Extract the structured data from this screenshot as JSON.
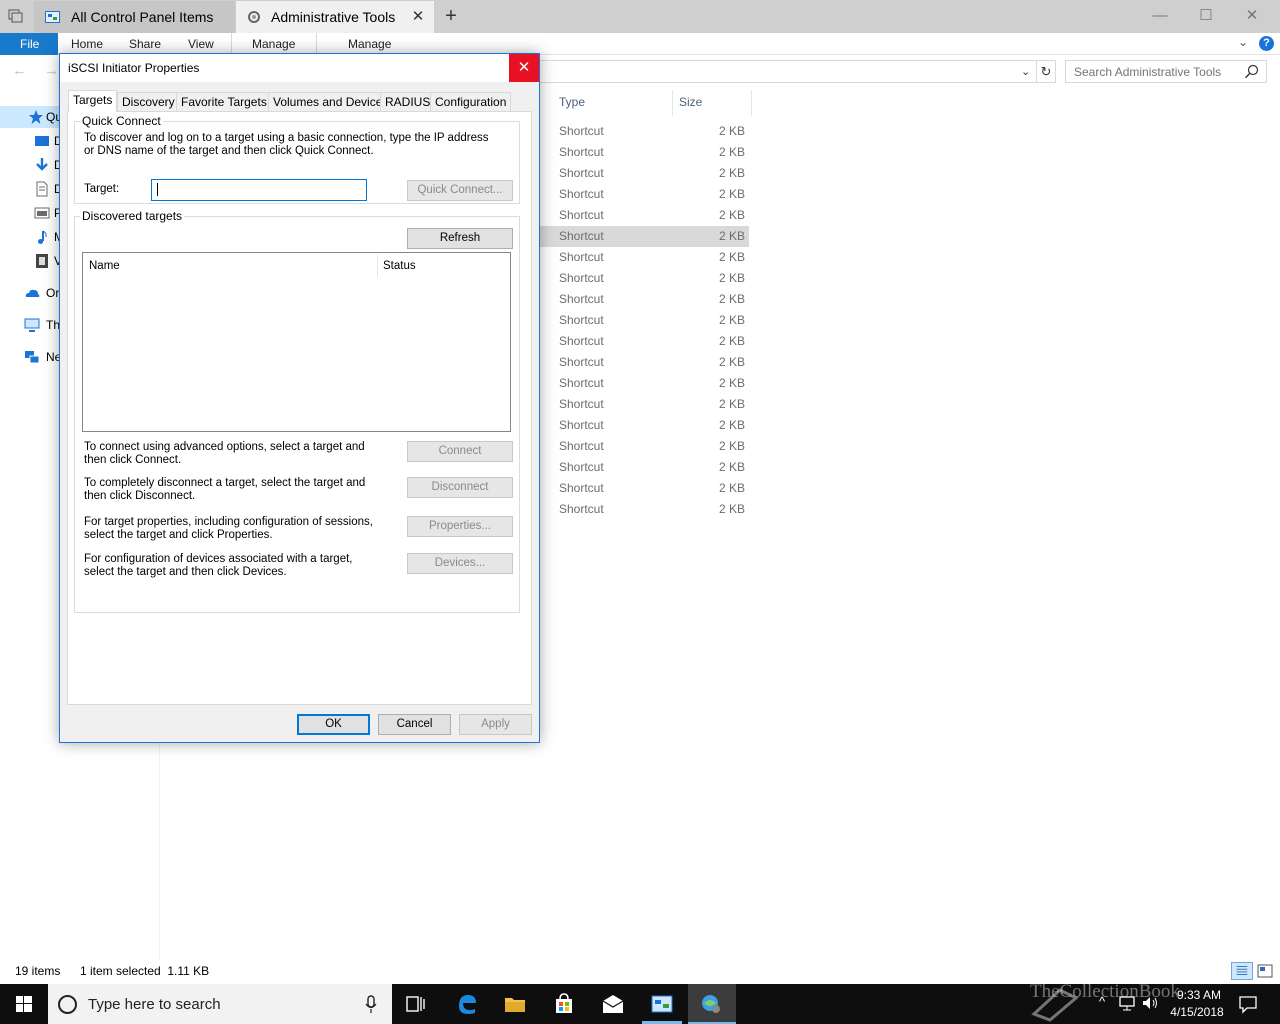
{
  "window": {
    "tabs": [
      {
        "label": "All Control Panel Items"
      },
      {
        "label": "Administrative Tools"
      }
    ],
    "new_tab_glyph": "+",
    "close_glyph": "✕",
    "minimize_glyph": "—",
    "maximize_glyph": "☐"
  },
  "ribbon": {
    "file": "File",
    "tabs": [
      "Home",
      "Share",
      "View",
      "Manage",
      "Manage"
    ],
    "help": "?"
  },
  "nav": {
    "back_glyph": "←",
    "forward_glyph": "→",
    "search_placeholder": "Search Administrative Tools",
    "refresh_glyph": "↻"
  },
  "sidebar": {
    "items": [
      {
        "label": "Qu",
        "icon": "star-icon",
        "color": "#1a73d6"
      },
      {
        "label": "D",
        "icon": "desktop-icon",
        "color": "#1a73d6"
      },
      {
        "label": "D",
        "icon": "download-icon",
        "color": "#1a73d6"
      },
      {
        "label": "D",
        "icon": "documents-icon",
        "color": "#6b6b6b"
      },
      {
        "label": "P",
        "icon": "pictures-icon",
        "color": "#6b6b6b"
      },
      {
        "label": "M",
        "icon": "music-icon",
        "color": "#1a73d6"
      },
      {
        "label": "V",
        "icon": "videos-icon",
        "color": "#444"
      },
      {
        "label": "Or",
        "icon": "onedrive-icon",
        "color": "#1a73d6"
      },
      {
        "label": "Th",
        "icon": "this-pc-icon",
        "color": "#1a73d6"
      },
      {
        "label": "Ne",
        "icon": "network-icon",
        "color": "#1a73d6"
      }
    ]
  },
  "filelist": {
    "columns": {
      "type": "Type",
      "size": "Size"
    },
    "rows": [
      {
        "type": "Shortcut",
        "size": "2 KB"
      },
      {
        "type": "Shortcut",
        "size": "2 KB"
      },
      {
        "type": "Shortcut",
        "size": "2 KB"
      },
      {
        "type": "Shortcut",
        "size": "2 KB"
      },
      {
        "type": "Shortcut",
        "size": "2 KB"
      },
      {
        "type": "Shortcut",
        "size": "2 KB",
        "selected": true
      },
      {
        "type": "Shortcut",
        "size": "2 KB"
      },
      {
        "type": "Shortcut",
        "size": "2 KB"
      },
      {
        "type": "Shortcut",
        "size": "2 KB"
      },
      {
        "type": "Shortcut",
        "size": "2 KB"
      },
      {
        "type": "Shortcut",
        "size": "2 KB"
      },
      {
        "type": "Shortcut",
        "size": "2 KB"
      },
      {
        "type": "Shortcut",
        "size": "2 KB"
      },
      {
        "type": "Shortcut",
        "size": "2 KB"
      },
      {
        "type": "Shortcut",
        "size": "2 KB"
      },
      {
        "type": "Shortcut",
        "size": "2 KB"
      },
      {
        "type": "Shortcut",
        "size": "2 KB"
      },
      {
        "type": "Shortcut",
        "size": "2 KB"
      },
      {
        "type": "Shortcut",
        "size": "2 KB"
      }
    ]
  },
  "statusbar": {
    "count": "19 items",
    "selection": "1 item selected  1.11 KB"
  },
  "dialog": {
    "title": "iSCSI Initiator Properties",
    "close": "✕",
    "tabs": [
      "Targets",
      "Discovery",
      "Favorite Targets",
      "Volumes and Devices",
      "RADIUS",
      "Configuration"
    ],
    "active_tab": "Targets",
    "quick_connect": {
      "group": "Quick Connect",
      "description": "To discover and log on to a target using a basic connection, type the IP address or DNS name of the target and then click Quick Connect.",
      "target_label": "Target:",
      "target_value": "",
      "button": "Quick Connect..."
    },
    "discovered": {
      "group": "Discovered targets",
      "refresh": "Refresh",
      "col_name": "Name",
      "col_status": "Status"
    },
    "actions": [
      {
        "text": "To connect using advanced options, select a target and then click Connect.",
        "button": "Connect"
      },
      {
        "text": "To completely disconnect a target, select the target and then click Disconnect.",
        "button": "Disconnect"
      },
      {
        "text": "For target properties, including configuration of sessions, select the target and click Properties.",
        "button": "Properties..."
      },
      {
        "text": "For configuration of devices associated with a target, select the target and then click Devices.",
        "button": "Devices..."
      }
    ],
    "ok": "OK",
    "cancel": "Cancel",
    "apply": "Apply"
  },
  "taskbar": {
    "search_placeholder": "Type here to search",
    "time": "9:33 AM",
    "date": "4/15/2018",
    "watermark": "TheCollectionBook",
    "accent": "#76b9ed"
  }
}
